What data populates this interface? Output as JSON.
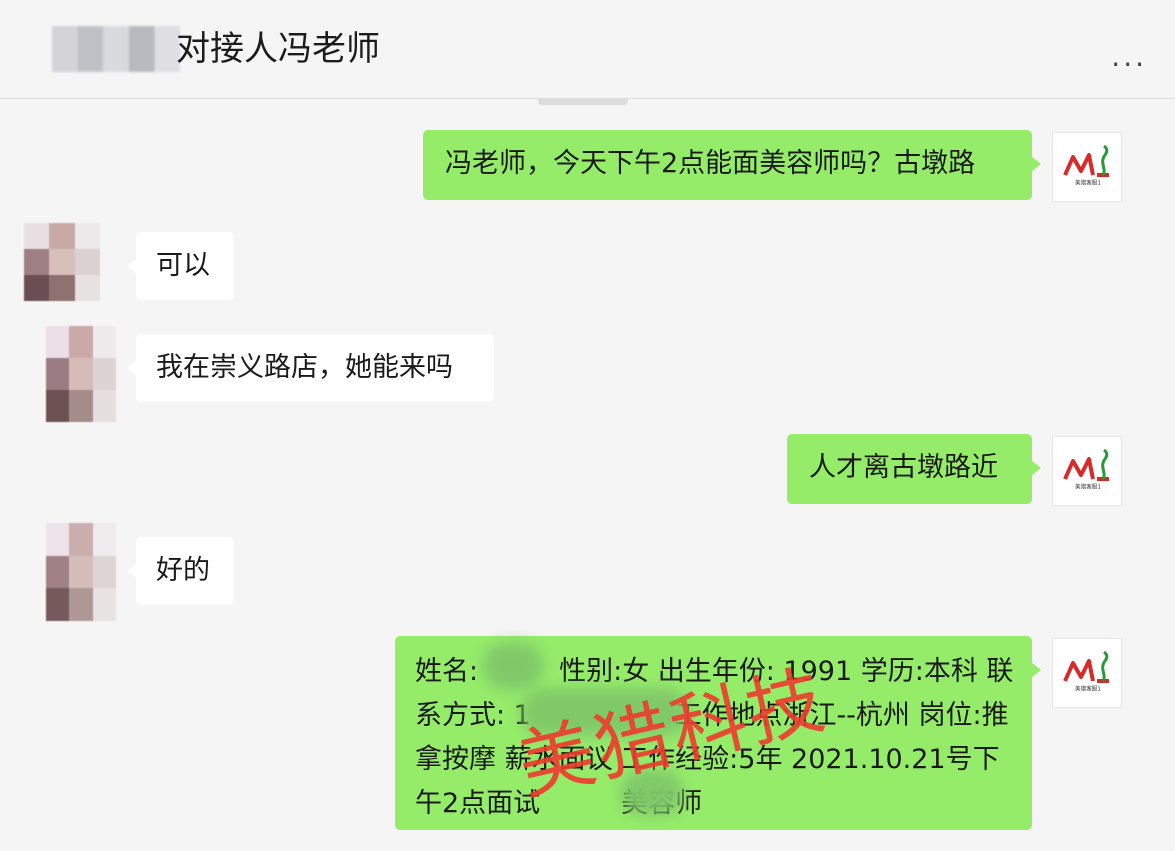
{
  "header": {
    "title": "对接人冯老师",
    "more_label": "...",
    "title_blur_char": "全"
  },
  "brand": {
    "avatar_logo": "ML",
    "avatar_caption": "美猎客服1"
  },
  "colors": {
    "my_bubble": "#95ec69",
    "their_bubble": "#ffffff",
    "background": "#f5f5f5",
    "watermark": "#ee3b2e"
  },
  "messages": [
    {
      "from": "me",
      "text": "冯老师，今天下午2点能面美容师吗？古墩路"
    },
    {
      "from": "them",
      "text": "可以"
    },
    {
      "from": "them",
      "text": "我在崇义路店，她能来吗"
    },
    {
      "from": "me",
      "text": "人才离古墩路近"
    },
    {
      "from": "them",
      "text": "好的"
    },
    {
      "from": "me",
      "text": "姓名:　　　性别:女 出生年份: 1991 学历:本科 联系方式: 1　　　　　 工作地点浙江--杭州 岗位:推拿按摩 薪水面议 工作经验:5年 2021.10.21号下午2点面试　　　美容师"
    }
  ],
  "watermark": "美猎科技"
}
